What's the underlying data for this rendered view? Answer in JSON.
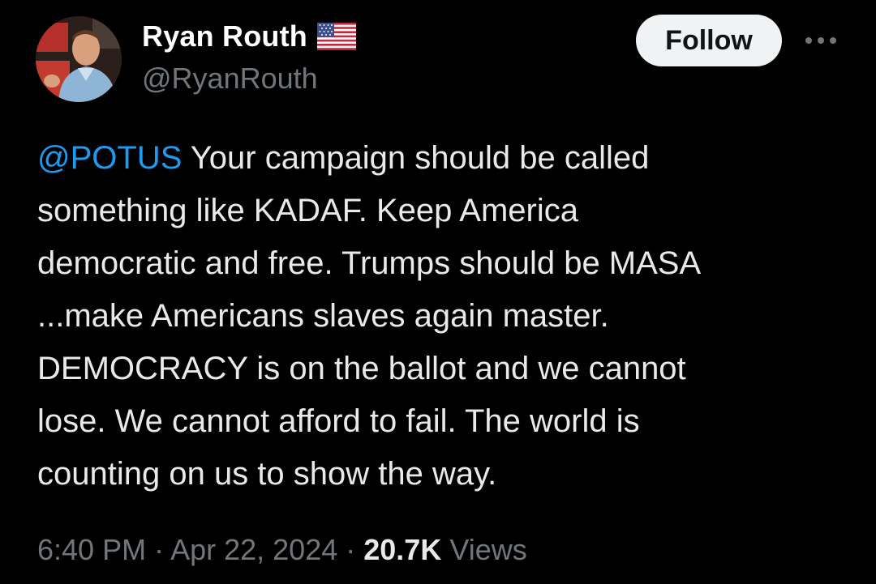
{
  "author": {
    "display_name": "Ryan Routh",
    "handle": "@RyanRouth",
    "badge_icon": "us-flag-icon",
    "avatar_icon": "profile-photo"
  },
  "actions": {
    "follow_label": "Follow",
    "more_icon": "more-horizontal-icon"
  },
  "tweet": {
    "mention": "@POTUS",
    "line_1": " Your campaign should be called",
    "line_2": "something like KADAF. Keep America",
    "line_3": "democratic and free. Trumps should be MASA",
    "line_4": "...make Americans slaves again master.",
    "line_5": "DEMOCRACY is on the ballot and we cannot",
    "line_6": "lose. We cannot afford to fail. The world is",
    "line_7": "counting on us to show the way."
  },
  "meta": {
    "time": "6:40 PM",
    "separator": " · ",
    "date": "Apr 22, 2024",
    "views_count": "20.7K",
    "views_label": " Views"
  },
  "colors": {
    "background": "#000000",
    "text_primary": "#e7e9ea",
    "text_secondary": "#71767b",
    "link": "#1d9bf0",
    "follow_bg": "#eff3f4"
  }
}
